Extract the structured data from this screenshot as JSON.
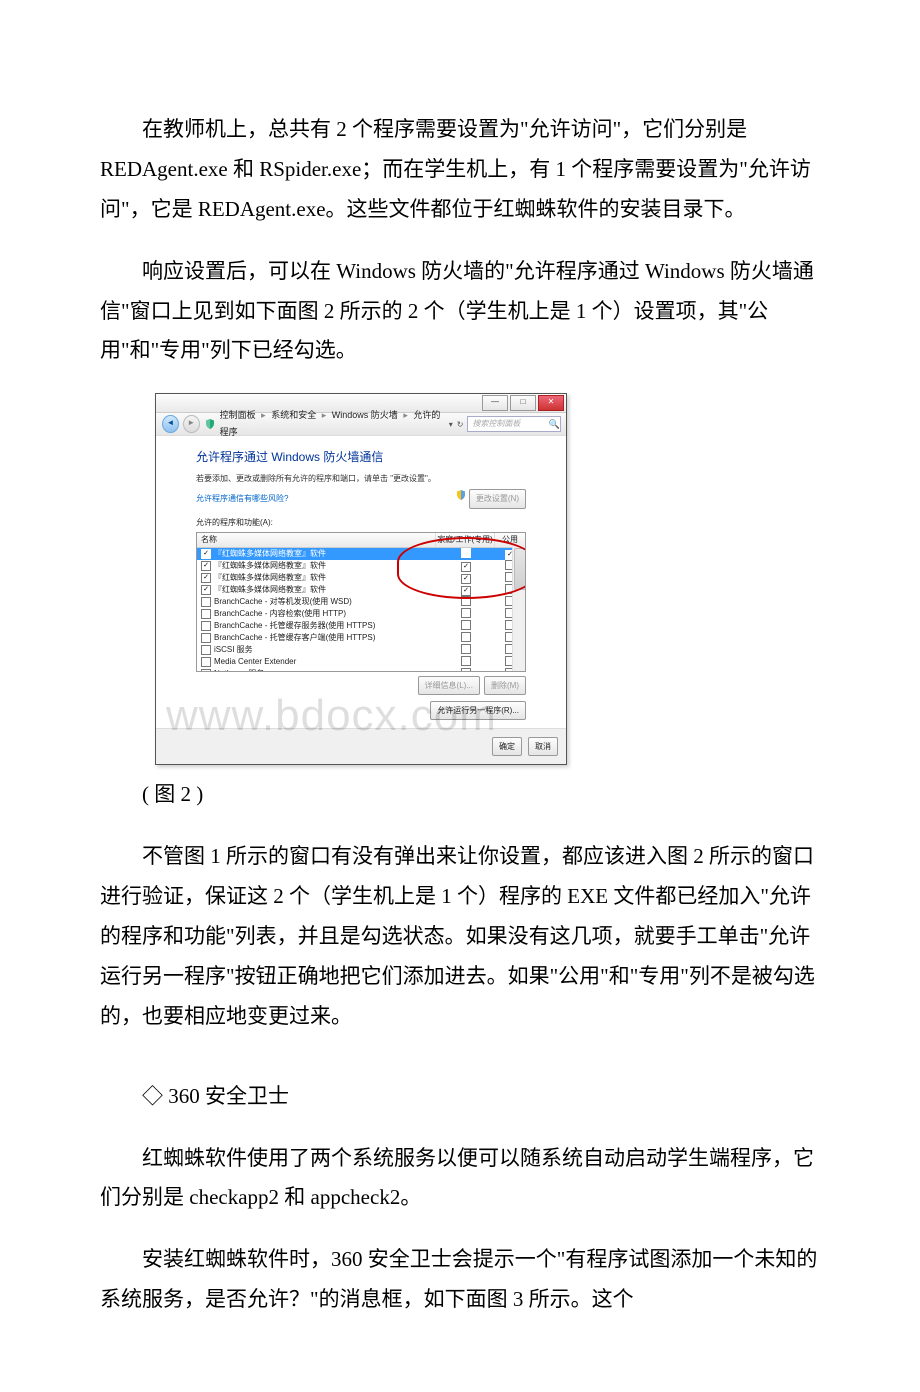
{
  "paragraphs": {
    "p1": "在教师机上，总共有 2 个程序需要设置为\"允许访问\"，它们分别是 REDAgent.exe 和 RSpider.exe；而在学生机上，有 1 个程序需要设置为\"允许访问\"，它是 REDAgent.exe。这些文件都位于红蜘蛛软件的安装目录下。",
    "p2": "响应设置后，可以在 Windows 防火墙的\"允许程序通过 Windows 防火墙通信\"窗口上见到如下面图 2 所示的 2 个（学生机上是 1 个）设置项，其\"公用\"和\"专用\"列下已经勾选。",
    "caption": "( 图 2 )",
    "p3": "不管图 1 所示的窗口有没有弹出来让你设置，都应该进入图 2 所示的窗口进行验证，保证这 2 个（学生机上是 1 个）程序的 EXE 文件都已经加入\"允许的程序和功能\"列表，并且是勾选状态。如果没有这几项，就要手工单击\"允许运行另一程序\"按钮正确地把它们添加进去。如果\"公用\"和\"专用\"列不是被勾选的，也要相应地变更过来。",
    "section": "◇ 360 安全卫士",
    "p4": "红蜘蛛软件使用了两个系统服务以便可以随系统自动启动学生端程序，它们分别是 checkapp2 和 appcheck2。",
    "p5": "安装红蜘蛛软件时，360 安全卫士会提示一个\"有程序试图添加一个未知的系统服务，是否允许？\"的消息框，如下面图 3 所示。这个"
  },
  "dialog": {
    "breadcrumb": {
      "root": "控制面板",
      "l1": "系统和安全",
      "l2": "Windows 防火墙",
      "l3": "允许的程序"
    },
    "search_placeholder": "搜索控制面板",
    "heading": "允许程序通过 Windows 防火墙通信",
    "subtext": "若要添加、更改或删除所有允许的程序和端口，请单击 \"更改设置\"。",
    "risk_link": "允许程序通信有哪些风险?",
    "change_settings_btn": "更改设置(N)",
    "list_label": "允许的程序和功能(A):",
    "columns": {
      "name": "名称",
      "private": "家庭/工作(专用)",
      "public": "公用"
    },
    "rows": [
      {
        "checked": true,
        "label": "『红蜘蛛多媒体网络教室』软件",
        "priv": false,
        "pub": true,
        "selected": true
      },
      {
        "checked": true,
        "label": "『红蜘蛛多媒体网络教室』软件",
        "priv": true,
        "pub": false,
        "selected": false
      },
      {
        "checked": true,
        "label": "『红蜘蛛多媒体网络教室』软件",
        "priv": true,
        "pub": false,
        "selected": false
      },
      {
        "checked": true,
        "label": "『红蜘蛛多媒体网络教室』软件",
        "priv": true,
        "pub": false,
        "selected": false
      },
      {
        "checked": false,
        "label": "BranchCache - 对等机发现(使用 WSD)",
        "priv": false,
        "pub": false,
        "selected": false
      },
      {
        "checked": false,
        "label": "BranchCache - 内容检索(使用 HTTP)",
        "priv": false,
        "pub": false,
        "selected": false
      },
      {
        "checked": false,
        "label": "BranchCache - 托管缓存服务器(使用 HTTPS)",
        "priv": false,
        "pub": false,
        "selected": false
      },
      {
        "checked": false,
        "label": "BranchCache - 托管缓存客户端(使用 HTTPS)",
        "priv": false,
        "pub": false,
        "selected": false
      },
      {
        "checked": false,
        "label": "iSCSI 服务",
        "priv": false,
        "pub": false,
        "selected": false
      },
      {
        "checked": false,
        "label": "Media Center Extender",
        "priv": false,
        "pub": false,
        "selected": false
      },
      {
        "checked": false,
        "label": "Netlogon 服务",
        "priv": false,
        "pub": false,
        "selected": false
      }
    ],
    "details_btn": "详细信息(L)...",
    "remove_btn": "删除(M)",
    "allow_another_btn": "允许运行另一程序(R)...",
    "ok_btn": "确定",
    "cancel_btn": "取消"
  },
  "watermark": "www.bdocx.com"
}
